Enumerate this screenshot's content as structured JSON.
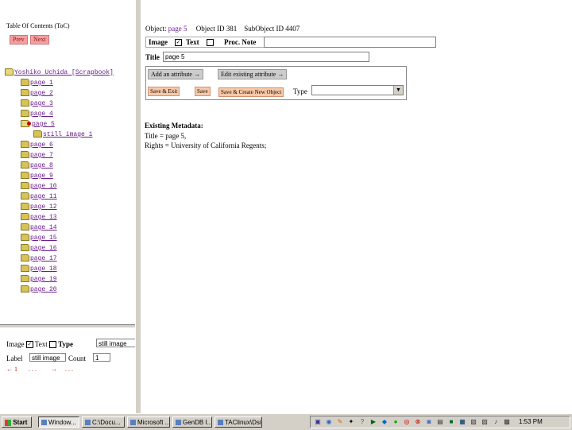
{
  "toc": {
    "title": "Table Of Contents (ToC)",
    "prev_label": "Prev",
    "next_label": "Next",
    "root_label": "Yoshiko Uchida [Scrapbook]",
    "pages_before": [
      "page 1",
      "page 2",
      "page 3",
      "page 4"
    ],
    "current_page": "page 5",
    "current_child": "still image 1",
    "pages_after": [
      "page 6",
      "page 7",
      "page 8",
      "page 9",
      "page 10",
      "page 11",
      "page 12",
      "page 13",
      "page 14",
      "page 15",
      "page 16",
      "page 17",
      "page 18",
      "page 19",
      "page 20"
    ]
  },
  "bottom_left": {
    "image_label": "Image",
    "text_label": "Text",
    "type_label": "Type",
    "type_value": "still image",
    "label_label": "Label",
    "label_value": "still image",
    "count_label": "Count",
    "count_value": "1",
    "nav1": "← 1",
    "nav2": ". . .",
    "nav3": "→",
    "nav4": ". . ."
  },
  "main": {
    "object_prefix": "Object:",
    "object_name": "page 5",
    "object_id": "Object ID 381",
    "subobject_id": "SubObject ID 4407",
    "image_label": "Image",
    "text_label": "Text",
    "proc_note_label": "Proc. Note",
    "title_label": "Title",
    "title_value": "page 5",
    "tab_add": "Add an attribute →",
    "tab_edit": "Edit existing attribute →",
    "save_exit": "Save & Exit",
    "save": "Save",
    "save_create": "Save & Create New Object",
    "type_label": "Type",
    "existing_metadata_heading": "Existing Metadata:",
    "metadata_line1": "Title = page 5,",
    "metadata_line2": "Rights = University of California Regents;"
  },
  "taskbar": {
    "start": "Start",
    "tasks": [
      "Window...",
      "C:\\Docu...",
      "Microsoft ...",
      "GenDB I...",
      "TAClinux\\Dsi L..."
    ],
    "clock": "1:53 PM"
  }
}
